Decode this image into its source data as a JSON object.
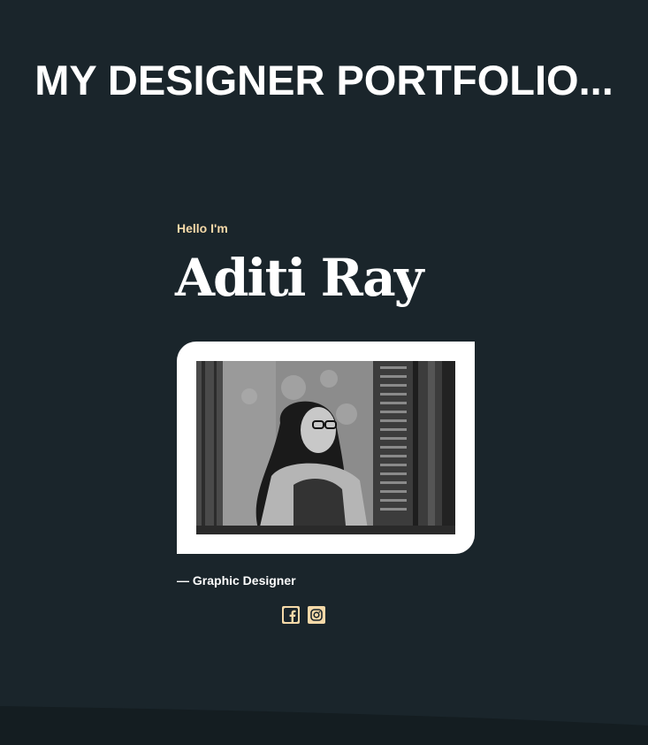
{
  "header": {
    "title": "MY DESIGNER PORTFOLIO..."
  },
  "hero": {
    "greeting": "Hello I'm",
    "name": "Aditi Ray",
    "role": "— Graphic Designer",
    "photo_alt": "Black and white photo of Aditi Ray sitting in front of an old doorway"
  },
  "socials": [
    {
      "icon": "facebook-icon",
      "label": "Facebook"
    },
    {
      "icon": "instagram-icon",
      "label": "Instagram"
    }
  ],
  "colors": {
    "background": "#1a252b",
    "accent": "#f5d9a8",
    "text": "#ffffff",
    "bottom_band": "#141d21"
  }
}
